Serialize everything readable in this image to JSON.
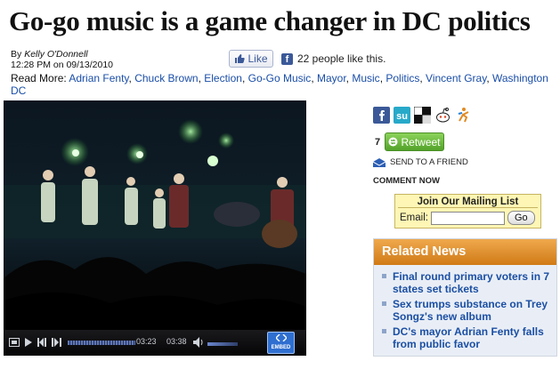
{
  "article": {
    "headline": "Go-go music is a game changer in DC politics",
    "byline_prefix": "By",
    "author": "Kelly O'Donnell",
    "datetime": "12:28 PM on 09/13/2010"
  },
  "facebook": {
    "like_label": "Like",
    "fb_glyph": "f",
    "like_count_text": "22 people like this."
  },
  "read_more": {
    "label": "Read More:",
    "tags": [
      "Adrian Fenty",
      "Chuck Brown",
      "Election",
      "Go-Go Music",
      "Mayor",
      "Music",
      "Politics",
      "Vincent Gray",
      "Washington DC"
    ]
  },
  "video": {
    "current_time": "03:23",
    "total_time": "03:38",
    "embed_label": "EMBED",
    "progress": 0.93
  },
  "share": {
    "icons": [
      "facebook-icon",
      "stumbleupon-icon",
      "delicious-icon",
      "reddit-icon",
      "digg-icon"
    ],
    "tweet_count": "7",
    "retweet_label": "Retweet",
    "send_to_friend": "SEND TO A FRIEND",
    "comment_now": "COMMENT NOW"
  },
  "mailing_list": {
    "title": "Join Our Mailing List",
    "email_label": "Email:",
    "email_value": "",
    "go_label": "Go"
  },
  "related_news": {
    "title": "Related News",
    "items": [
      "Final round primary voters in 7 states set tickets",
      "Sex trumps substance on Trey Songz's new album",
      "DC's mayor Adrian Fenty falls from public favor"
    ]
  },
  "colors": {
    "link": "#1a4ea8",
    "related_header": "#e08a24",
    "retweet_green": "#6bbd3f",
    "facebook_blue": "#3b5998"
  }
}
